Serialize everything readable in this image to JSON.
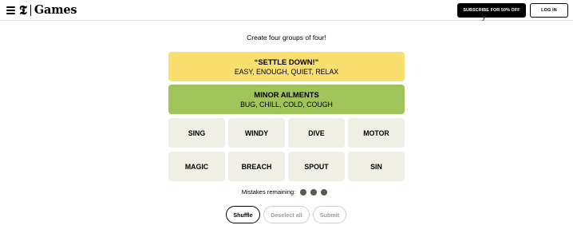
{
  "header": {
    "logo_mark": "𝕿",
    "logo_text": "Games",
    "subscribe_label": "SUBSCRIBE FOR 50% OFF",
    "login_label": "LOG IN",
    "cutoff_glyph": "y"
  },
  "instructions": "Create four groups of four!",
  "solved_groups": [
    {
      "title": "“SETTLE DOWN!”",
      "members": "EASY, ENOUGH, QUIET, RELAX",
      "color": "#f9df6d"
    },
    {
      "title": "MINOR AILMENTS",
      "members": "BUG, CHILL, COLD, COUGH",
      "color": "#a0c35a"
    }
  ],
  "tiles": [
    "SING",
    "WINDY",
    "DIVE",
    "MOTOR",
    "MAGIC",
    "BREACH",
    "SPOUT",
    "SIN"
  ],
  "mistakes": {
    "label": "Mistakes remaining:",
    "remaining": 3
  },
  "buttons": {
    "shuffle": "Shuffle",
    "deselect": "Deselect all",
    "submit": "Submit"
  },
  "colors": {
    "tile_bg": "#efefe6",
    "dot": "#5a594e",
    "yellow": "#f9df6d",
    "green": "#a0c35a"
  }
}
